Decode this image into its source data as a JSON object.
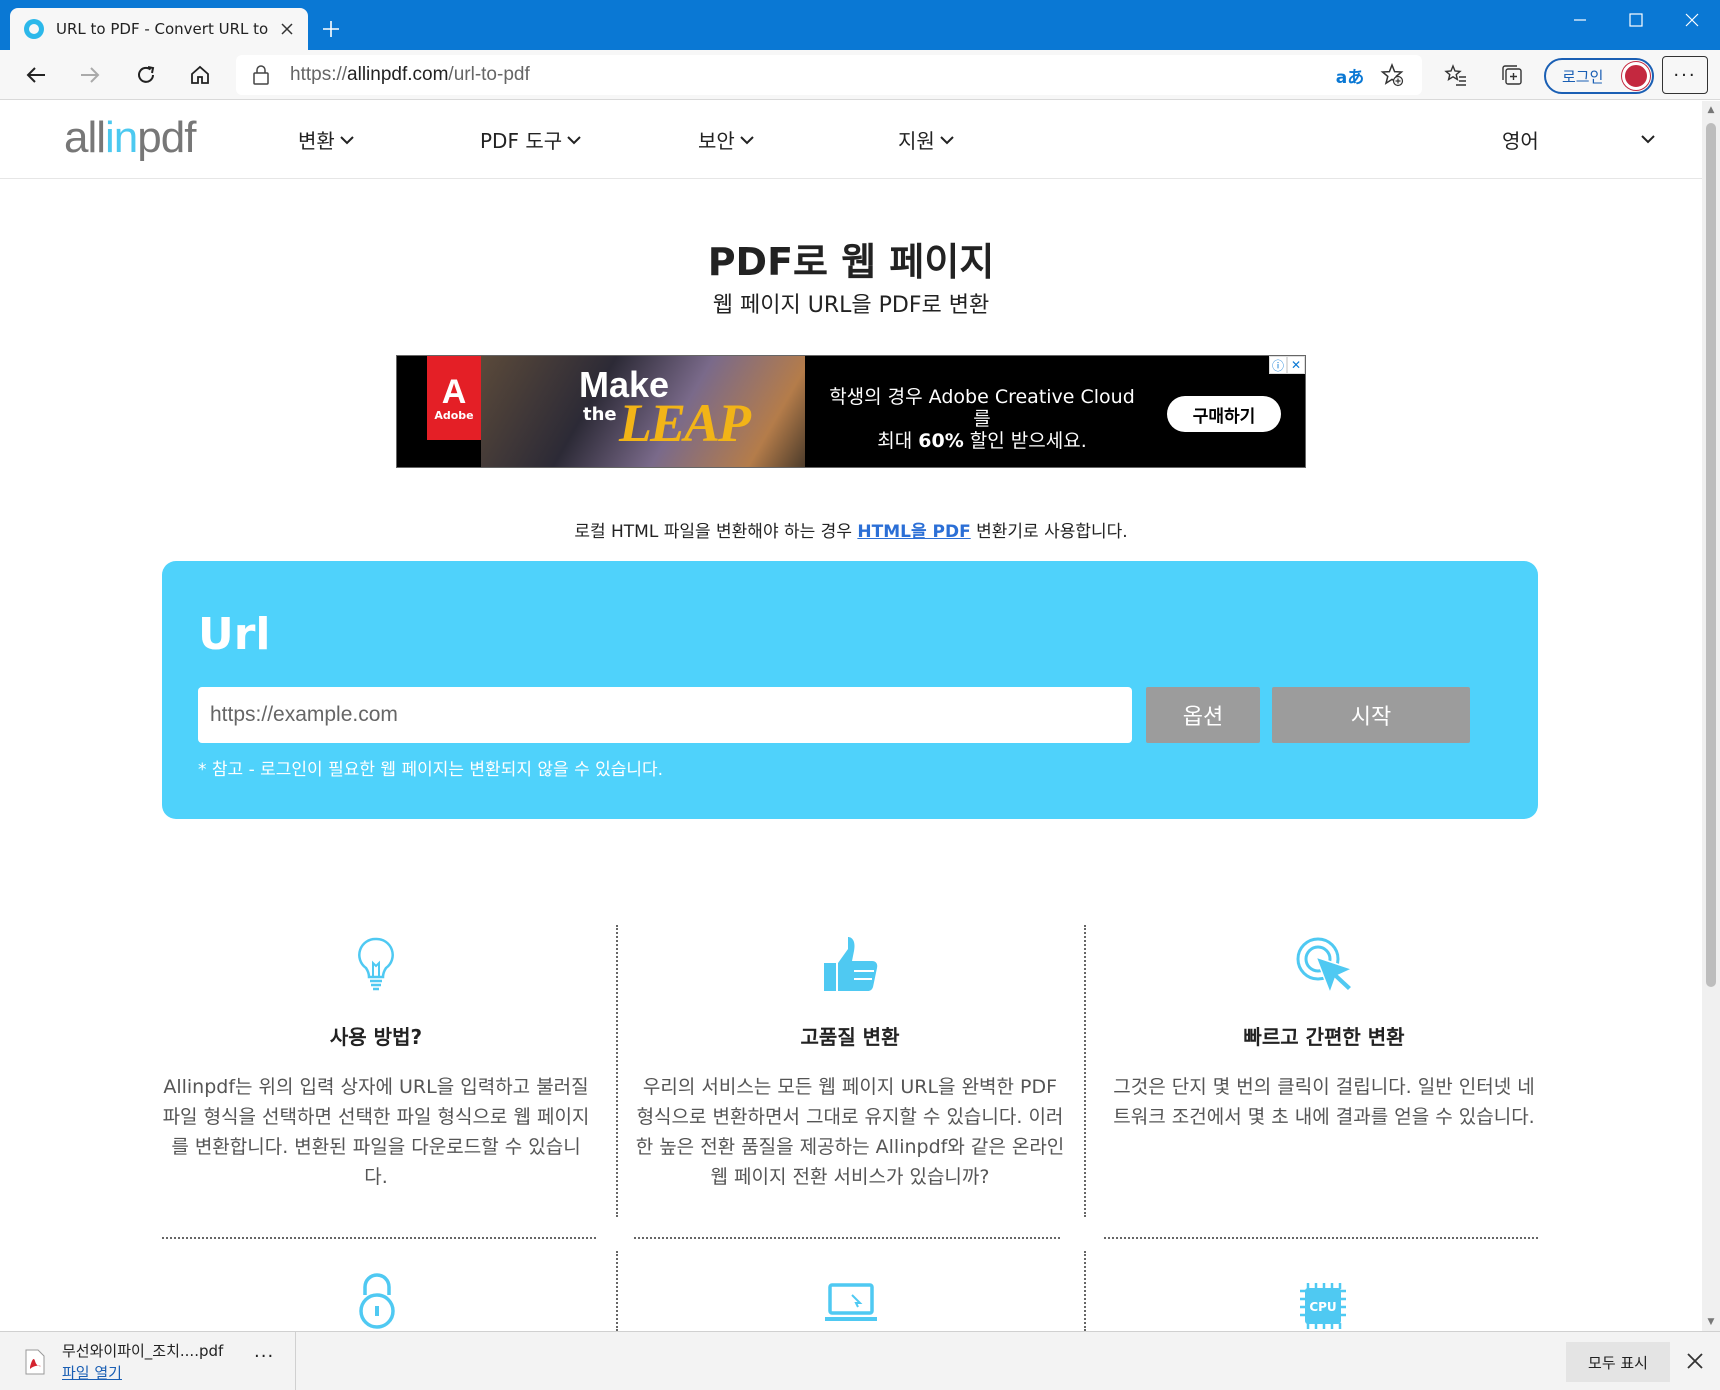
{
  "browser": {
    "tab_title": "URL to PDF - Convert URL to PDF",
    "new_tab_glyph": "+",
    "address_prefix": "https://",
    "address_domain": "allinpdf.com",
    "address_path": "/url-to-pdf",
    "read_aloud_glyph": "aあ",
    "login_label": "로그인",
    "more_label": "···",
    "accent_color": "#0a78d4"
  },
  "site": {
    "logo_pre": "all",
    "logo_in": "in",
    "logo_post": "pdf",
    "nav": {
      "convert": "변환",
      "tools": "PDF 도구",
      "security": "보안",
      "support": "지원",
      "language": "영어"
    },
    "title": "PDF로 웹 페이지",
    "subtitle": "웹 페이지 URL을 PDF로 변환",
    "ad": {
      "brand": "Adobe",
      "brand_mark": "A",
      "headline_make": "Make",
      "headline_the": "the",
      "headline_leap": "LEAP",
      "copy_line1": "학생의 경우 Adobe Creative Cloud를",
      "copy_pre": "최대 ",
      "copy_bold": "60%",
      "copy_post": " 할인 받으세요.",
      "cta": "구매하기",
      "info_glyph": "ⓘ",
      "close_glyph": "✕"
    },
    "note": {
      "before": "로컬 HTML 파일을 변환해야 하는 경우 ",
      "link": "HTML을 PDF",
      "after": " 변환기로 사용합니다."
    },
    "converter": {
      "label": "Url",
      "placeholder": "https://example.com",
      "options_label": "옵션",
      "start_label": "시작",
      "hint": "* 참고 - 로그인이 필요한 웹 페이지는 변환되지 않을 수 있습니다.",
      "box_color": "#4fd2fb"
    },
    "features": [
      {
        "icon": "lightbulb-icon",
        "title": "사용 방법?",
        "text": "Allinpdf는 위의 입력 상자에 URL을 입력하고 불러질 파일 형식을 선택하면 선택한 파일 형식으로 웹 페이지를 변환합니다. 변환된 파일을 다운로드할 수 있습니다."
      },
      {
        "icon": "thumbs-up-icon",
        "title": "고품질 변환",
        "text": "우리의 서비스는 모든 웹 페이지 URL을 완벽한 PDF 형식으로 변환하면서 그대로 유지할 수 있습니다. 이러한 높은 전환 품질을 제공하는 Allinpdf와 같은 온라인 웹 페이지 전환 서비스가 있습니까?"
      },
      {
        "icon": "click-pointer-icon",
        "title": "빠르고 간편한 변환",
        "text": "그것은 단지 몇 번의 클릭이 걸립니다. 일반 인터넷 네트워크 조건에서 몇 초 내에 결과를 얻을 수 있습니다."
      }
    ],
    "lower_icons": [
      "padlock-icon",
      "laptop-icon",
      "cpu-chip-icon"
    ],
    "cpu_label": "CPU"
  },
  "downloads": {
    "filename": "무선와이파이_조치....pdf",
    "open_label": "파일 열기",
    "more_label": "···",
    "show_all_label": "모두 표시"
  }
}
